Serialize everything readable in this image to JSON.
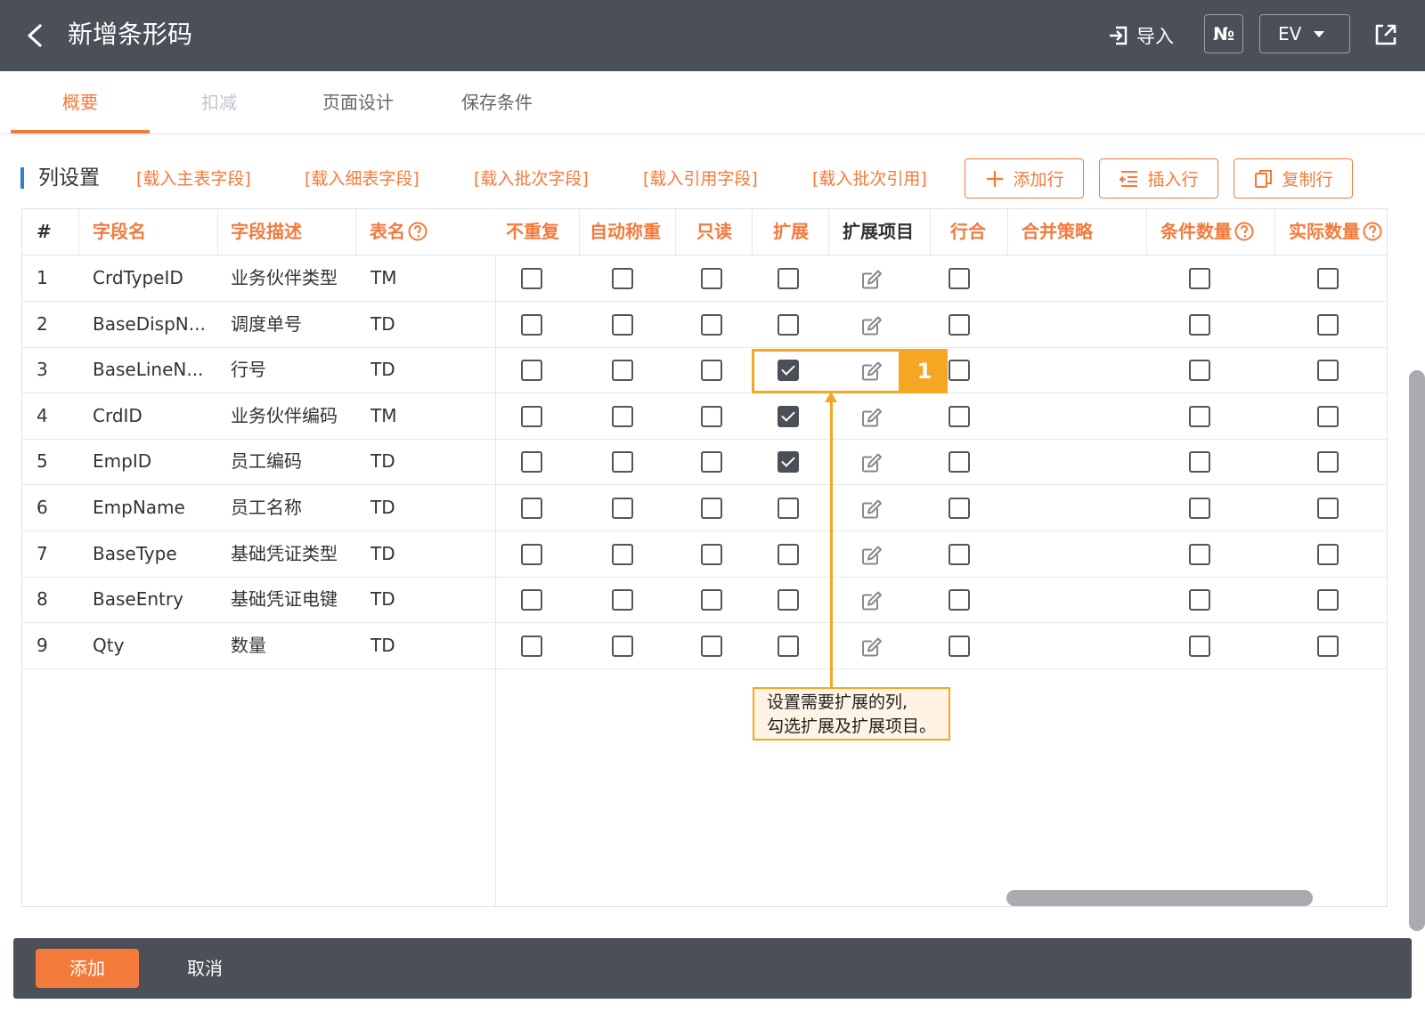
{
  "header": {
    "title": "新增条形码",
    "import_label": "导入",
    "no_label": "№",
    "ev_label": "EV"
  },
  "tabs": [
    {
      "label": "概要",
      "state": "active"
    },
    {
      "label": "扣减",
      "state": "disabled"
    },
    {
      "label": "页面设计",
      "state": "normal"
    },
    {
      "label": "保存条件",
      "state": "normal"
    }
  ],
  "section": {
    "title": "列设置",
    "links": [
      "[载入主表字段]",
      "[载入细表字段]",
      "[载入批次字段]",
      "[载入引用字段]",
      "[载入批次引用]"
    ],
    "buttons": {
      "add_row": "添加行",
      "insert_row": "插入行",
      "copy_row": "复制行"
    }
  },
  "table": {
    "columns": [
      "#",
      "字段名",
      "字段描述",
      "表名",
      "不重复",
      "自动称重",
      "只读",
      "扩展",
      "扩展项目",
      "行合",
      "合并策略",
      "条件数量",
      "实际数量"
    ],
    "rows": [
      {
        "num": "1",
        "field": "CrdTypeID",
        "desc": "业务伙伴类型",
        "table": "TM",
        "expand": false
      },
      {
        "num": "2",
        "field": "BaseDispN...",
        "desc": "调度单号",
        "table": "TD",
        "expand": false
      },
      {
        "num": "3",
        "field": "BaseLineN...",
        "desc": "行号",
        "table": "TD",
        "expand": true
      },
      {
        "num": "4",
        "field": "CrdID",
        "desc": "业务伙伴编码",
        "table": "TM",
        "expand": true
      },
      {
        "num": "5",
        "field": "EmpID",
        "desc": "员工编码",
        "table": "TD",
        "expand": true
      },
      {
        "num": "6",
        "field": "EmpName",
        "desc": "员工名称",
        "table": "TD",
        "expand": false
      },
      {
        "num": "7",
        "field": "BaseType",
        "desc": "基础凭证类型",
        "table": "TD",
        "expand": false
      },
      {
        "num": "8",
        "field": "BaseEntry",
        "desc": "基础凭证电键",
        "table": "TD",
        "expand": false
      },
      {
        "num": "9",
        "field": "Qty",
        "desc": "数量",
        "table": "TD",
        "expand": false
      }
    ]
  },
  "annotation": {
    "badge": "1",
    "tip_line1": "设置需要扩展的列,",
    "tip_line2": "勾选扩展及扩展项目。"
  },
  "footer": {
    "add_label": "添加",
    "cancel_label": "取消"
  },
  "colors": {
    "header_bg": "#4a4f58",
    "accent": "#f47a3c",
    "annotation": "#f5a623",
    "section_bar": "#2f7fd8"
  }
}
